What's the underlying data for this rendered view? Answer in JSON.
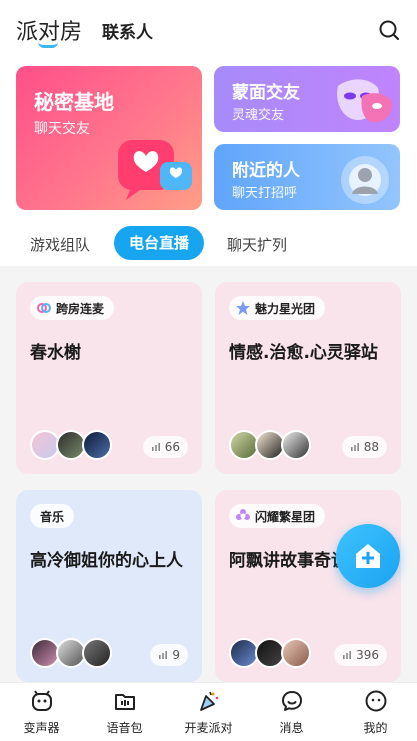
{
  "header": {
    "tab_main": "派对房",
    "tab_contacts": "联系人"
  },
  "feature_cards": {
    "secret_base": {
      "title": "秘密基地",
      "subtitle": "聊天交友"
    },
    "masked": {
      "title": "蒙面交友",
      "subtitle": "灵魂交友"
    },
    "nearby": {
      "title": "附近的人",
      "subtitle": "聊天打招呼"
    }
  },
  "subtabs": [
    "游戏组队",
    "电台直播",
    "聊天扩列"
  ],
  "active_subtab": "电台直播",
  "rooms": [
    {
      "tag": "跨房连麦",
      "title": "春水榭",
      "count": "66",
      "theme": "pink"
    },
    {
      "tag": "魅力星光团",
      "title": "情感.治愈.心灵驿站",
      "count": "88",
      "theme": "pink"
    },
    {
      "tag": "音乐",
      "title": "高冷御姐你的心上人",
      "count": "9",
      "theme": "blue"
    },
    {
      "tag": "闪耀繁星团",
      "title": "阿飘讲故事奇谈",
      "count": "396",
      "theme": "pink"
    }
  ],
  "bottom_nav": [
    "变声器",
    "语音包",
    "开麦派对",
    "消息",
    "我的"
  ],
  "colors": {
    "accent": "#16a5ee",
    "pink_card": "#ff5f8a",
    "purple_card": "#b78af9",
    "blue_card": "#7ab4f8"
  }
}
